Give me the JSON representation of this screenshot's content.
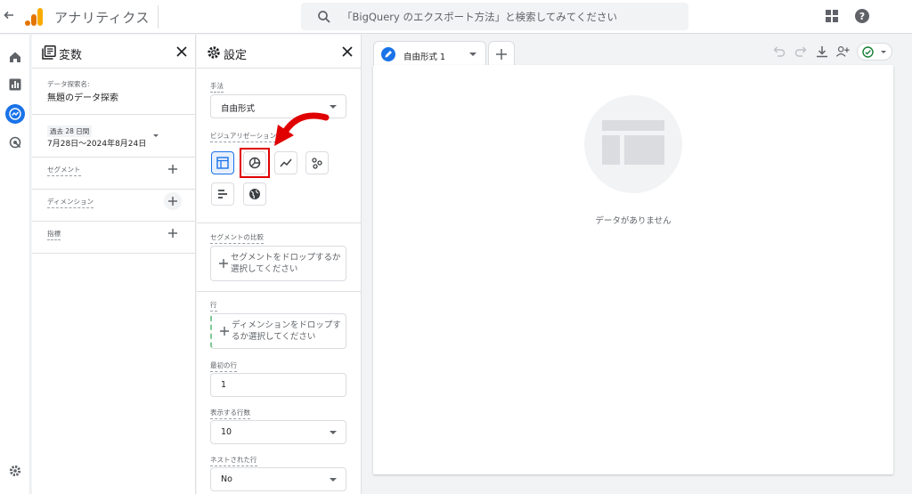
{
  "app": {
    "title": "アナリティクス"
  },
  "search": {
    "placeholder": "「BigQuery のエクスポート方法」と検索してみてください"
  },
  "variables_panel": {
    "title": "変数",
    "exploration_name_label": "データ探索名:",
    "exploration_name": "無題のデータ探索",
    "date_range_label": "過去 28 日間",
    "date_range": "7月28日～2024年8月24日",
    "segments_label": "セグメント",
    "dimensions_label": "ディメンション",
    "metrics_label": "指標"
  },
  "settings_panel": {
    "title": "設定",
    "technique_label": "手法",
    "technique_value": "自由形式",
    "visualization_label": "ビジュアリゼーション",
    "segment_compare_label": "セグメントの比較",
    "segment_drop_text": "セグメントをドロップするか選択してください",
    "rows_label": "行",
    "rows_drop_text": "ディメンションをドロップするか選択してください",
    "first_row_label": "最初の行",
    "first_row_value": "1",
    "rows_shown_label": "表示する行数",
    "rows_shown_value": "10",
    "nested_rows_label": "ネストされた行",
    "nested_rows_value": "No"
  },
  "canvas": {
    "tab_label": "自由形式 1",
    "empty_text": "データがありません"
  },
  "colors": {
    "accent": "#1a73e8",
    "highlight": "#e00000",
    "logo_orange": "#f9ab00",
    "logo_dark": "#e37400"
  }
}
